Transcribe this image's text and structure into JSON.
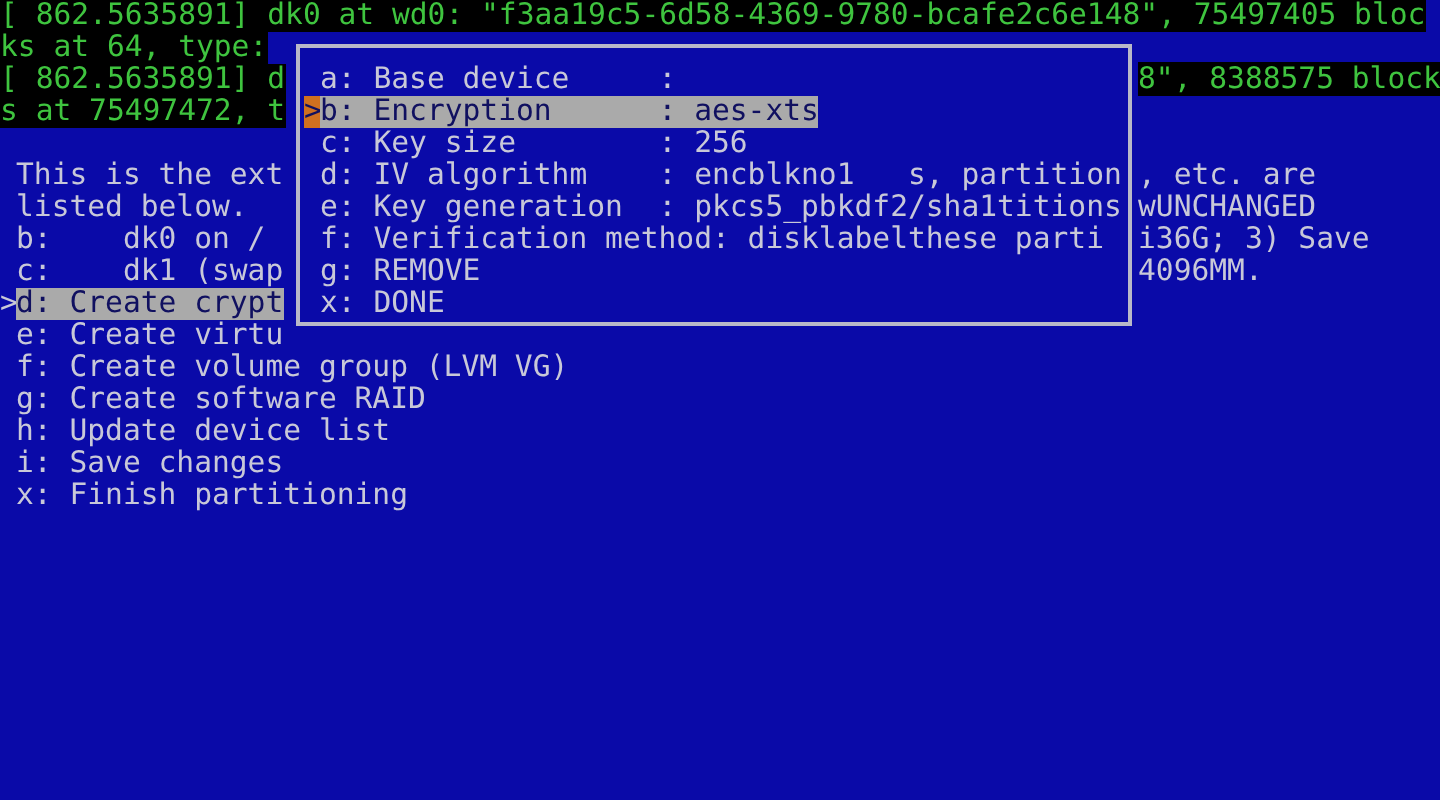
{
  "cursor": ">",
  "rows": [
    {
      "kind": "log",
      "text": "[ 862.5635891] dk0 at wd0: \"f3aa19c5-6d58-4369-9780-bcafe2c6e148\", 75497405 bloc"
    },
    {
      "kind": "log",
      "text": "ks at 64, type:"
    },
    {
      "kind": "log",
      "text": "[ 862.5635891] d",
      "right": "8\", 8388575 block"
    },
    {
      "kind": "log",
      "text": "s at 75497472, t"
    },
    {
      "kind": "blank"
    },
    {
      "kind": "text",
      "selected": false,
      "text": "This is the ext",
      "right": ", etc. are"
    },
    {
      "kind": "text",
      "selected": false,
      "text": "listed below.",
      "right": "wUNCHANGED"
    },
    {
      "kind": "text",
      "selected": false,
      "text": "b:    dk0 on /",
      "right": "i36G; 3) Save"
    },
    {
      "kind": "text",
      "selected": false,
      "text": "c:    dk1 (swap",
      "right": "4096MM."
    },
    {
      "kind": "text",
      "selected": true,
      "text": "d: Create crypt"
    },
    {
      "kind": "text",
      "selected": false,
      "text": "e: Create virtu"
    },
    {
      "kind": "text",
      "selected": false,
      "text": "f: Create volume group (LVM VG)"
    },
    {
      "kind": "text",
      "selected": false,
      "text": "g: Create software RAID"
    },
    {
      "kind": "text",
      "selected": false,
      "text": "h: Update device list"
    },
    {
      "kind": "text",
      "selected": false,
      "text": "i: Save changes"
    },
    {
      "kind": "text",
      "selected": false,
      "text": "x: Finish partitioning"
    }
  ],
  "popup": {
    "cursor": ">",
    "items": [
      {
        "selected": false,
        "text": "a: Base device     :"
      },
      {
        "selected": true,
        "text": "b: Encryption      : aes-xts"
      },
      {
        "selected": false,
        "text": "c: Key size        : 256"
      },
      {
        "selected": false,
        "text": "d: IV algorithm    : encblkno1   s, partition"
      },
      {
        "selected": false,
        "text": "e: Key generation  : pkcs5_pbkdf2/sha1titions"
      },
      {
        "selected": false,
        "text": "f: Verification method: disklabelthese parti"
      },
      {
        "selected": false,
        "text": "g: REMOVE"
      },
      {
        "selected": false,
        "text": "x: DONE"
      }
    ]
  }
}
